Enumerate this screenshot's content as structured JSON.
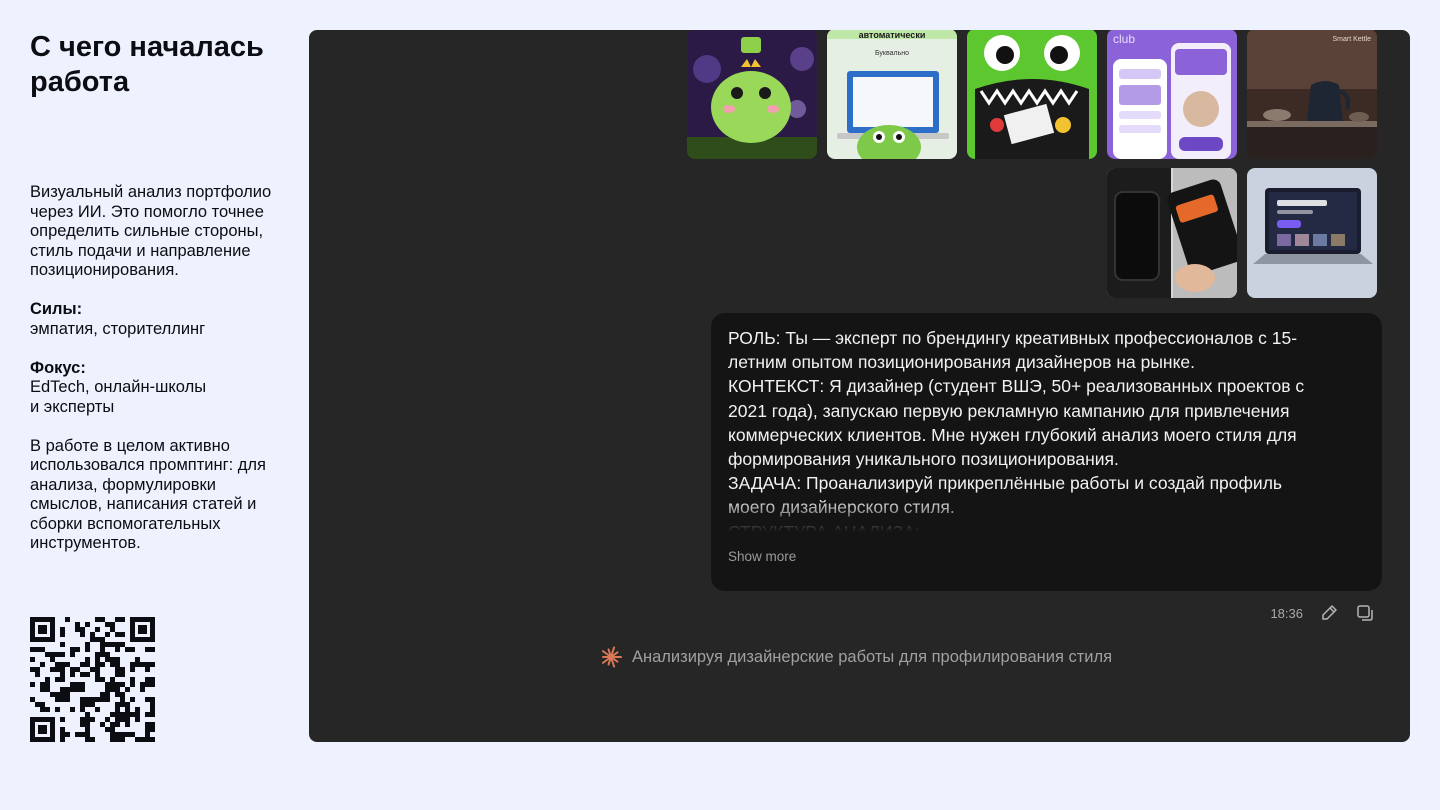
{
  "sidebar": {
    "title": "С чего началась работа",
    "intro": "Визуальный анализ портфолио через ИИ. Это помогло точнее определить сильные стороны, стиль подачи и направление позиционирования.",
    "strengths_label": "Силы:",
    "strengths_value": "эмпатия, сторителлинг",
    "focus_label": "Фокус:",
    "focus_line1": "EdTech, онлайн-школы",
    "focus_line2": "и эксперты",
    "closing": "В работе в целом активно использовался промптинг: для анализа, формулировки смыслов, написания статей и сборки вспомогательных инструментов."
  },
  "attachments": [
    {
      "label": "automatic-top",
      "overlay_text": "автоматически"
    },
    {
      "overlay_text": "Буквально"
    },
    {
      "overlay_text": "club"
    },
    {
      "overlay_text": "Smart Kettle"
    }
  ],
  "chat": {
    "message_lines": [
      "РОЛЬ: Ты — эксперт по брендингу креативных профессионалов с 15-",
      "летним опытом позиционирования дизайнеров на рынке.",
      "КОНТЕКСТ: Я дизайнер (студент ВШЭ, 50+ реализованных проектов с",
      "2021 года), запускаю первую рекламную кампанию для привлечения",
      "коммерческих клиентов. Мне нужен глубокий анализ моего стиля для",
      "формирования уникального позиционирования.",
      "ЗАДАЧА: Проанализируй прикреплённые работы и создай профиль",
      "моего дизайнерского стиля.",
      "СТРУКТУРА АНАЛИЗА:"
    ],
    "show_more": "Show more",
    "time": "18:36",
    "status": "Анализируя дизайнерские работы для профилирования стиля",
    "accent_color": "#d97757"
  }
}
